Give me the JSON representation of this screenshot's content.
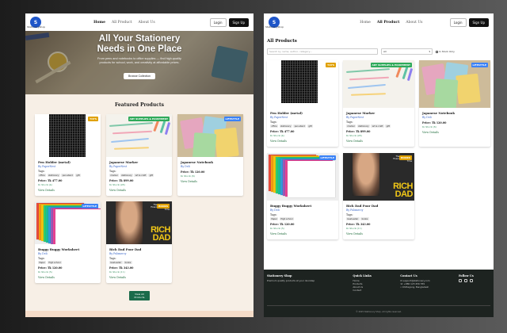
{
  "brand": {
    "logo_letter": "S",
    "logo_caption": "StationeryShop",
    "name": "Stationery Shop"
  },
  "nav": {
    "home": "Home",
    "products": "All Product",
    "about": "About Us",
    "login": "Login",
    "signup": "Sign Up"
  },
  "hero": {
    "title_line1": "All Your Stationery",
    "title_line2": "Needs in One Place",
    "subtitle": "From pens and notebooks to office supplies — find high-quality products for school, work, and creativity at affordable prices.",
    "cta": "Browse Collection"
  },
  "featured": {
    "title": "Featured Products",
    "view_all": "View All Products",
    "items": [
      {
        "name": "Pen Holder (metal)",
        "by": "By PaperNest",
        "tags_label": "Tags:",
        "tags": [
          "office",
          "stationery",
          "pen-stand",
          "gift"
        ],
        "price": "Price: Tk 477.00",
        "stock": "In Stock (4)",
        "view": "View Details",
        "badge": "TOYS",
        "badge_color": "#e0a100"
      },
      {
        "name": "Japanese Marker",
        "by": "By PaperNest",
        "tags_label": "Tags:",
        "tags": [
          "marker",
          "stationery",
          "art & craft",
          "gift"
        ],
        "price": "Price: Tk 899.00",
        "stock": "In Stock (28)",
        "view": "View Details",
        "badge": "ART SUPPLIES & EQUIPMENT",
        "badge_color": "#2faa5a"
      },
      {
        "name": "Japanese Notebook",
        "by": "By Deli",
        "tags_label": "",
        "tags": [],
        "price": "Price: Tk 120.00",
        "stock": "In Stock (6)",
        "view": "View Details",
        "badge": "LIFESTYLE",
        "badge_color": "#3b82f6"
      },
      {
        "name": "Buggy Buggy Worksheet",
        "by": "By Deli",
        "tags_label": "Tags:",
        "tags": [
          "Paper",
          "High school"
        ],
        "price": "Price: Tk 120.00",
        "stock": "In Stock (5)",
        "view": "View Details",
        "badge": "LIFESTYLE",
        "badge_color": "#3b82f6"
      },
      {
        "name": "Rich Dad Poor Dad",
        "by": "By Pubmercy",
        "tags_label": "Tags:",
        "tags": [
          "best-seller",
          "books"
        ],
        "price": "Price: Tk 343.00",
        "stock": "In Stock (11)",
        "view": "View Details",
        "badge": "BOOKS",
        "badge_color": "#e0a100"
      }
    ]
  },
  "catalog": {
    "title": "All Products",
    "search_placeholder": "Search by name, author, category...",
    "category_value": "All",
    "in_stock_label": "In Stock Only",
    "items": [
      {
        "name": "Pen Holder (metal)",
        "by": "By PaperNest",
        "tags_label": "Tags:",
        "tags": [
          "office",
          "stationery",
          "pen-stand",
          "gift"
        ],
        "price": "Price: Tk 477.00",
        "stock": "In Stock (4)",
        "view": "View Details",
        "badge": "TOYS",
        "badge_color": "#e0a100"
      },
      {
        "name": "Japanese Marker",
        "by": "By PaperNest",
        "tags_label": "Tags:",
        "tags": [
          "marker",
          "stationery",
          "art & craft",
          "gift"
        ],
        "price": "Price: Tk 899.00",
        "stock": "In Stock (28)",
        "view": "View Details",
        "badge": "ART SUPPLIES & EQUIPMENT",
        "badge_color": "#2faa5a"
      },
      {
        "name": "Japanese Notebook",
        "by": "By Deli",
        "tags_label": "",
        "tags": [],
        "price": "Price: Tk 120.00",
        "stock": "In Stock (6)",
        "view": "View Details",
        "badge": "LIFESTYLE",
        "badge_color": "#3b82f6"
      },
      {
        "name": "Buggy Buggy Worksheet",
        "by": "By Deli",
        "tags_label": "Tags:",
        "tags": [
          "Paper",
          "High school"
        ],
        "price": "Price: Tk 120.00",
        "stock": "In Stock (5)",
        "view": "View Details",
        "badge": "LIFESTYLE",
        "badge_color": "#3b82f6"
      },
      {
        "name": "Rich Dad Poor Dad",
        "by": "By Pubmercy",
        "tags_label": "Tags:",
        "tags": [
          "best-seller",
          "books"
        ],
        "price": "Price: Tk 343.00",
        "stock": "In Stock (11)",
        "view": "View Details",
        "badge": "BOOKS",
        "badge_color": "#e0a100"
      }
    ]
  },
  "book_cover": {
    "top": "The #1 Personal Finance Book of All Time",
    "line1": "RICH",
    "line2": "DAD"
  },
  "footer": {
    "brand": "Stationery Shop",
    "tagline": "Premium quality products at your doorstep",
    "quick_title": "Quick Links",
    "quick_links": [
      "Home",
      "Products",
      "About Us",
      "Contact"
    ],
    "contact_title": "Contact Us",
    "contact": [
      "support@stationery.com",
      "+880 123 456 789",
      "Chittagong, Bangladesh"
    ],
    "follow_title": "Follow Us",
    "copyright": "© 2025 Stationery Shop. All rights reserved."
  }
}
